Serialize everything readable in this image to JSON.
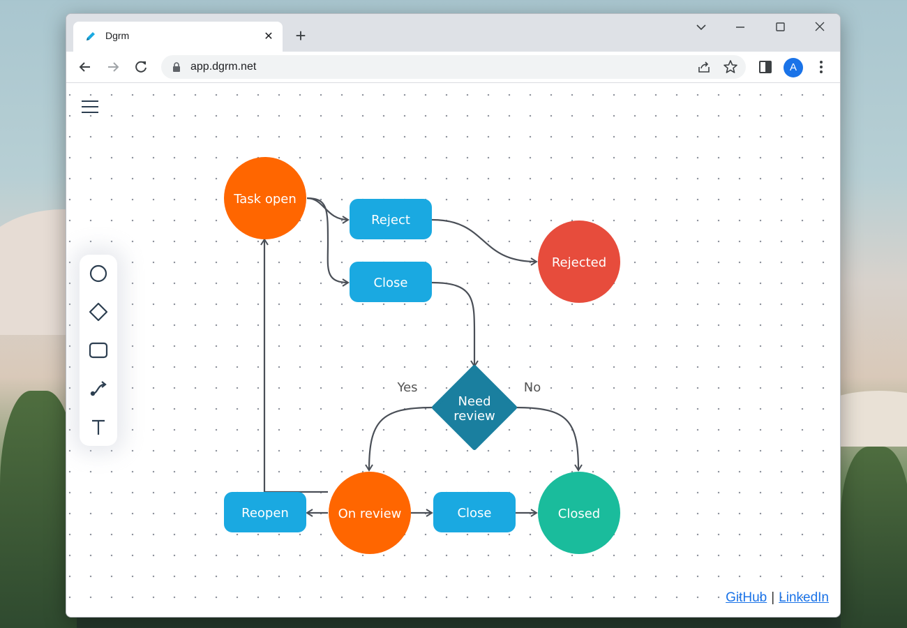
{
  "browser": {
    "tab_title": "Dgrm",
    "url": "app.dgrm.net",
    "avatar_letter": "A",
    "new_tab_label": "+",
    "close_tab_label": "✕"
  },
  "diagram": {
    "nodes": {
      "task_open": "Task open",
      "reject": "Reject",
      "close_top": "Close",
      "rejected": "Rejected",
      "need_review_line1": "Need",
      "need_review_line2": "review",
      "yes_label": "Yes",
      "no_label": "No",
      "reopen": "Reopen",
      "on_review": "On review",
      "close_bottom": "Close",
      "closed": "Closed"
    },
    "colors": {
      "orange": "#ff6600",
      "blue": "#1aa9e1",
      "red": "#e74c3c",
      "teal_diamond": "#1a7f9f",
      "green": "#1abc9c",
      "connector": "#4a4f57"
    }
  },
  "footer": {
    "github": "GitHub",
    "separator": "|",
    "linkedin": "LinkedIn"
  },
  "icons": [
    "pencil-icon",
    "close-icon",
    "plus-icon",
    "chevron-down-icon",
    "minimize-icon",
    "maximize-icon",
    "close-window-icon",
    "back-icon",
    "forward-icon",
    "reload-icon",
    "lock-icon",
    "share-icon",
    "star-icon",
    "sidepanel-icon",
    "kebab-icon",
    "menu-icon",
    "circle-tool-icon",
    "diamond-tool-icon",
    "rect-tool-icon",
    "connector-tool-icon",
    "text-tool-icon"
  ]
}
